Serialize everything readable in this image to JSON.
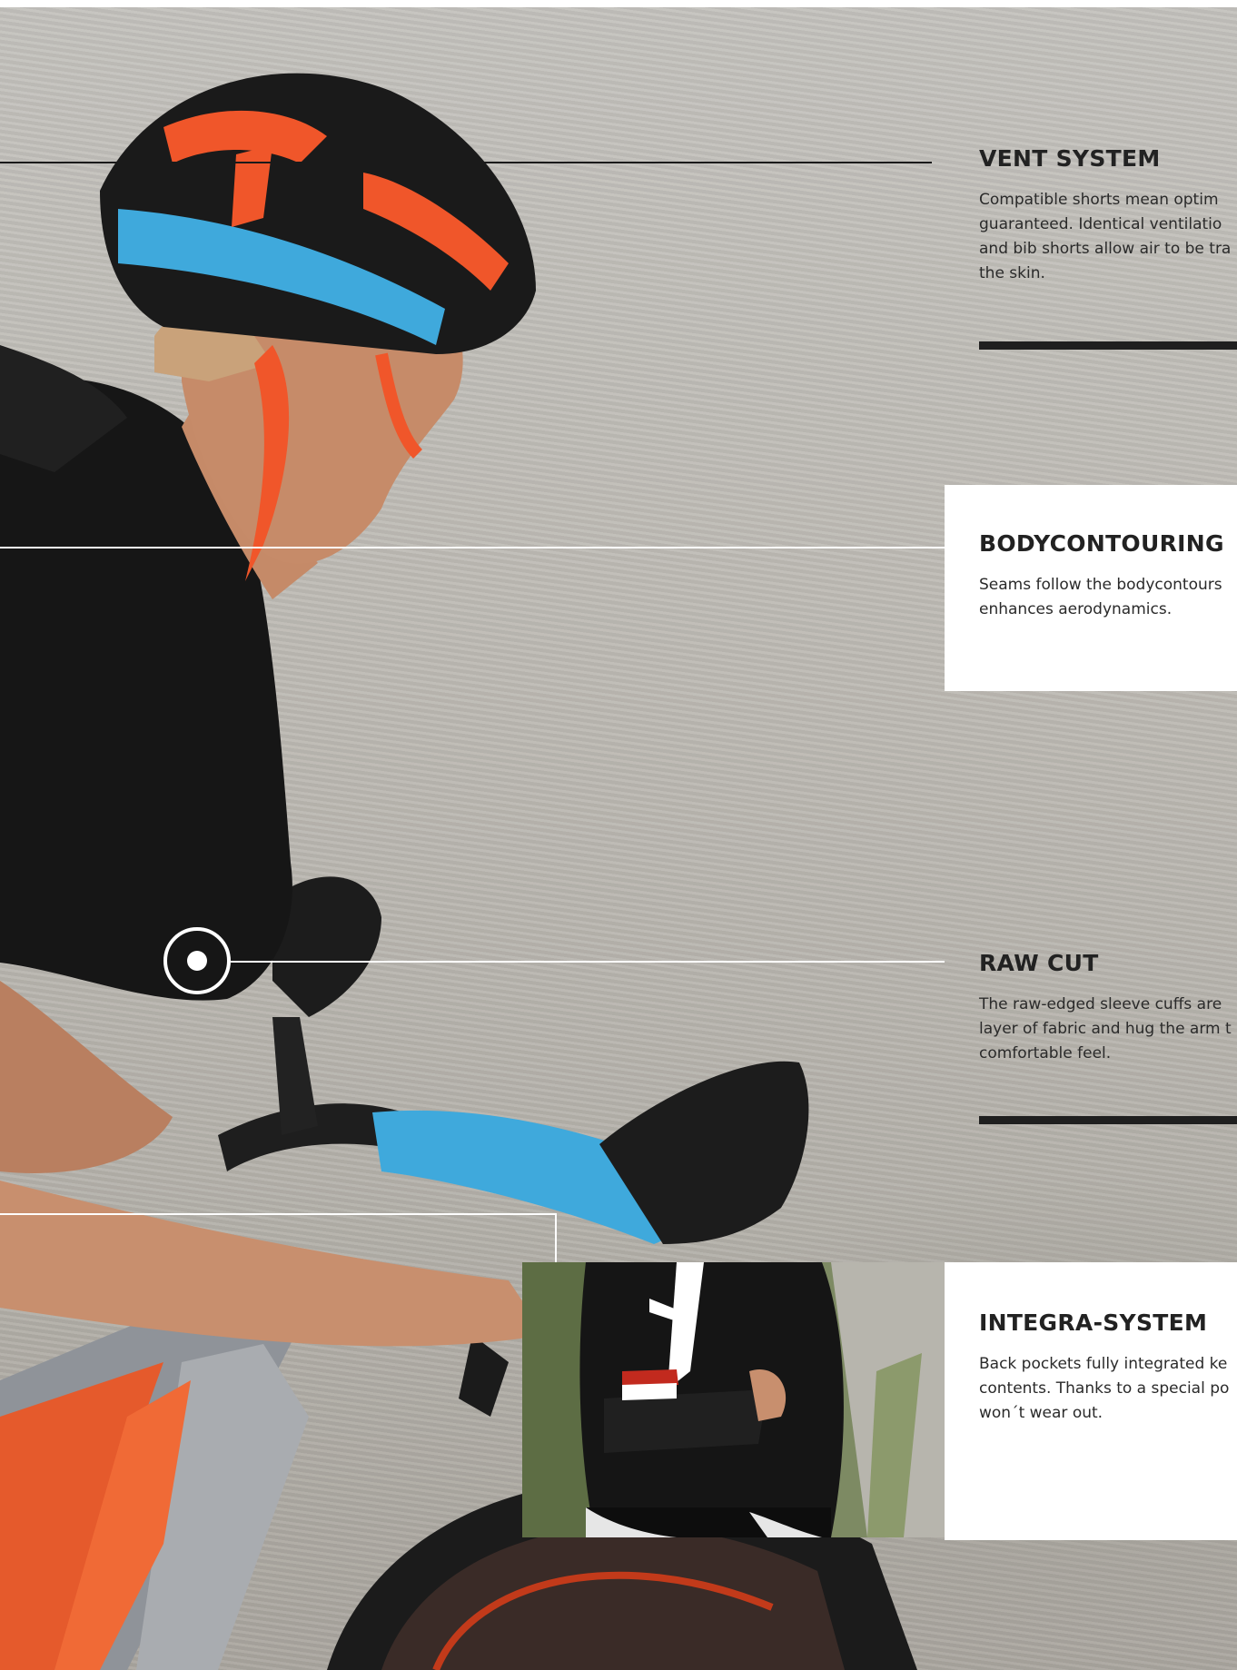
{
  "features": [
    {
      "title": "VENT SYSTEM",
      "text_lines": [
        "Compatible shorts mean optim",
        "guaranteed. Identical ventilatio",
        "and bib shorts allow air to be tra",
        "the skin."
      ]
    },
    {
      "title": "BODYCONTOURING",
      "text_lines": [
        "Seams follow the bodycontours",
        "enhances aerodynamics."
      ]
    },
    {
      "title": "RAW CUT",
      "text_lines": [
        "The raw-edged sleeve cuffs are",
        "layer of fabric and hug the arm t",
        "comfortable feel."
      ]
    },
    {
      "title": "INTEGRA-SYSTEM",
      "text_lines": [
        "Back pockets fully integrated ke",
        "contents. Thanks to a special po",
        "won´t wear out."
      ]
    }
  ],
  "colors": {
    "callout_line_dark": "#1a1a1a",
    "callout_line_light": "#ffffff",
    "accent_orange": "#f0562a",
    "accent_blue": "#3fa9dc"
  },
  "icons": {
    "callout_marker": "target-dot-icon"
  }
}
